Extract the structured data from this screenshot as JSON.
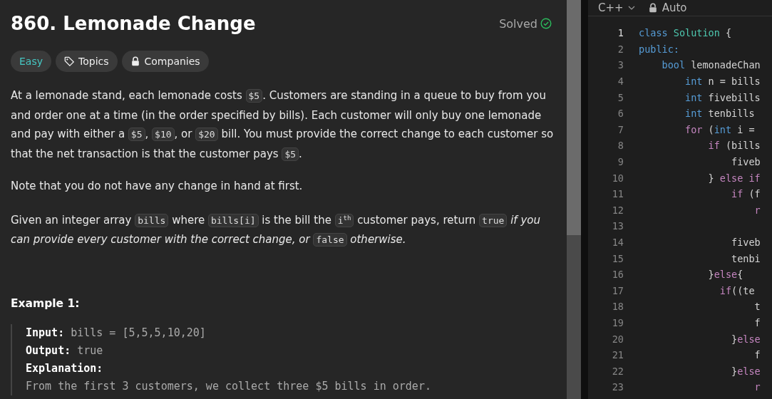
{
  "problem": {
    "title": "860. Lemonade Change",
    "status": "Solved",
    "solved": true,
    "tags": [
      {
        "kind": "difficulty",
        "label": "Easy"
      },
      {
        "kind": "topics",
        "label": "Topics"
      },
      {
        "kind": "companies",
        "label": "Companies"
      }
    ],
    "paragraphs": [
      [
        {
          "kind": "plain",
          "text": "At a lemonade stand, each lemonade costs "
        },
        {
          "kind": "code",
          "text": "$5"
        },
        {
          "kind": "plain",
          "text": ". Customers are standing in a queue to buy from you and order one at a time (in the order specified by bills). Each customer will only buy one lemonade and pay with either a "
        },
        {
          "kind": "code",
          "text": "$5"
        },
        {
          "kind": "plain",
          "text": ", "
        },
        {
          "kind": "code",
          "text": "$10"
        },
        {
          "kind": "plain",
          "text": ", or "
        },
        {
          "kind": "code",
          "text": "$20"
        },
        {
          "kind": "plain",
          "text": " bill. You must provide the correct change to each customer so that the net transaction is that the customer pays "
        },
        {
          "kind": "code",
          "text": "$5"
        },
        {
          "kind": "plain",
          "text": "."
        }
      ],
      [
        {
          "kind": "plain",
          "text": "Note that you do not have any change in hand at first."
        }
      ],
      [
        {
          "kind": "plain",
          "text": "Given an integer array "
        },
        {
          "kind": "code",
          "text": "bills"
        },
        {
          "kind": "plain",
          "text": " where "
        },
        {
          "kind": "code",
          "text": "bills[i]"
        },
        {
          "kind": "plain",
          "text": " is the bill the "
        },
        {
          "kind": "code",
          "text": "i$^{th}$"
        },
        {
          "kind": "plain",
          "text": " customer pays, return "
        },
        {
          "kind": "code",
          "text": "true"
        },
        {
          "kind": "italic",
          "text": " if you can provide every customer with the correct change, or "
        },
        {
          "kind": "code",
          "text": "false"
        },
        {
          "kind": "italic",
          "text": " otherwise."
        }
      ]
    ],
    "example": {
      "title": "Example 1:",
      "lines": [
        {
          "label": "Input:",
          "value": "bills = [5,5,5,10,20]"
        },
        {
          "label": "Output:",
          "value": "true"
        },
        {
          "label": "Explanation:"
        },
        {
          "value": "From the first 3 customers, we collect three $5 bills in order."
        }
      ]
    }
  },
  "editor": {
    "language": "C++",
    "mode": "Auto",
    "lines": [
      {
        "number": "1",
        "tokens": [
          {
            "kind": "keyword",
            "text": "class"
          },
          {
            "kind": "type",
            "text": " Solution"
          },
          {
            "kind": "plain",
            "text": " {"
          }
        ]
      },
      {
        "number": "2",
        "tokens": [
          {
            "kind": "keyword",
            "text": "public:"
          }
        ]
      },
      {
        "number": "3",
        "tokens": [
          {
            "kind": "keyword",
            "text": "    bool"
          },
          {
            "kind": "plain",
            "text": " lemonadeChan"
          }
        ]
      },
      {
        "number": "4",
        "tokens": [
          {
            "kind": "keyword",
            "text": "        int"
          },
          {
            "kind": "plain",
            "text": " n = bills"
          }
        ]
      },
      {
        "number": "5",
        "tokens": [
          {
            "kind": "keyword",
            "text": "        int"
          },
          {
            "kind": "plain",
            "text": " fivebills"
          }
        ]
      },
      {
        "number": "6",
        "tokens": [
          {
            "kind": "keyword",
            "text": "        int"
          },
          {
            "kind": "plain",
            "text": " tenbills"
          }
        ]
      },
      {
        "number": "7",
        "tokens": [
          {
            "kind": "control",
            "text": "        for"
          },
          {
            "kind": "plain",
            "text": " ("
          },
          {
            "kind": "keyword",
            "text": "int"
          },
          {
            "kind": "plain",
            "text": " i ="
          }
        ]
      },
      {
        "number": "8",
        "tokens": [
          {
            "kind": "control",
            "text": "            if"
          },
          {
            "kind": "plain",
            "text": " (bills"
          }
        ]
      },
      {
        "number": "9",
        "tokens": [
          {
            "kind": "plain",
            "text": "                fiveb"
          }
        ]
      },
      {
        "number": "10",
        "tokens": [
          {
            "kind": "plain",
            "text": "            } "
          },
          {
            "kind": "control",
            "text": "else if"
          }
        ]
      },
      {
        "number": "11",
        "tokens": [
          {
            "kind": "control",
            "text": "                if"
          },
          {
            "kind": "plain",
            "text": " (f"
          }
        ]
      },
      {
        "number": "12",
        "tokens": [
          {
            "kind": "control",
            "text": "                    r"
          }
        ]
      },
      {
        "number": "13"
      },
      {
        "number": "14",
        "tokens": [
          {
            "kind": "plain",
            "text": "                fiveb"
          }
        ]
      },
      {
        "number": "15",
        "tokens": [
          {
            "kind": "plain",
            "text": "                tenbi"
          }
        ]
      },
      {
        "number": "16",
        "tokens": [
          {
            "kind": "plain",
            "text": "            }"
          },
          {
            "kind": "control",
            "text": "else"
          },
          {
            "kind": "plain",
            "text": "{"
          }
        ]
      },
      {
        "number": "17",
        "tokens": [
          {
            "kind": "control",
            "text": "              if"
          },
          {
            "kind": "plain",
            "text": "((te"
          }
        ]
      },
      {
        "number": "18",
        "tokens": [
          {
            "kind": "plain",
            "text": "                    t"
          }
        ]
      },
      {
        "number": "19",
        "tokens": [
          {
            "kind": "plain",
            "text": "                    f"
          }
        ]
      },
      {
        "number": "20",
        "tokens": [
          {
            "kind": "plain",
            "text": "                }"
          },
          {
            "kind": "control",
            "text": "else"
          }
        ]
      },
      {
        "number": "21",
        "tokens": [
          {
            "kind": "plain",
            "text": "                    f"
          }
        ]
      },
      {
        "number": "22",
        "tokens": [
          {
            "kind": "plain",
            "text": "                }"
          },
          {
            "kind": "control",
            "text": "else"
          }
        ]
      },
      {
        "number": "23",
        "tokens": [
          {
            "kind": "control",
            "text": "                    r"
          }
        ]
      }
    ]
  }
}
